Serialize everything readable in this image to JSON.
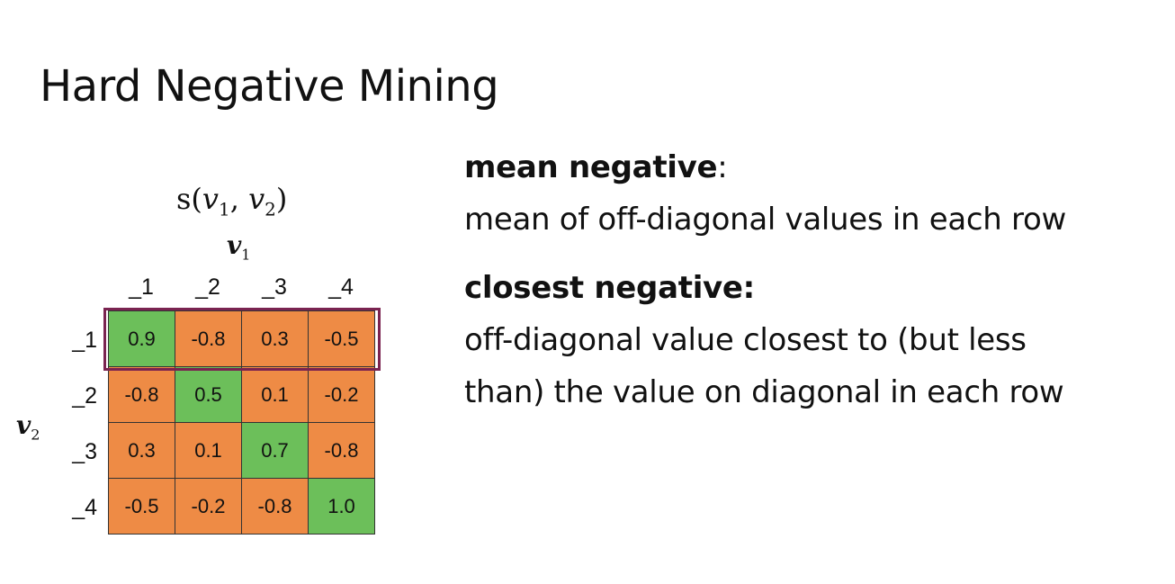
{
  "slide": {
    "title": "Hard Negative Mining"
  },
  "matrix": {
    "formula_prefix": "s(",
    "formula_v1": "v",
    "formula_v1_sub": "1",
    "formula_sep": ", ",
    "formula_v2": "v",
    "formula_v2_sub": "2",
    "formula_suffix": ")",
    "col_axis": "v",
    "col_axis_sub": "1",
    "row_axis": "v",
    "row_axis_sub": "2",
    "col_headers": [
      "_1",
      "_2",
      "_3",
      "_4"
    ],
    "row_headers": [
      "_1",
      "_2",
      "_3",
      "_4"
    ],
    "rows": [
      [
        "0.9",
        "-0.8",
        "0.3",
        "-0.5"
      ],
      [
        "-0.8",
        "0.5",
        "0.1",
        "-0.2"
      ],
      [
        "0.3",
        "0.1",
        "0.7",
        "-0.8"
      ],
      [
        "-0.5",
        "-0.2",
        "-0.8",
        "1.0"
      ]
    ],
    "colors": {
      "diagonal": "#6cbf5a",
      "off_diagonal": "#ee8b45",
      "highlight_border": "#7a2350"
    }
  },
  "definitions": {
    "mean_negative_term": "mean negative",
    "mean_negative_colon": ":",
    "mean_negative_desc": "mean of off-diagonal values in each row",
    "closest_negative_term": "closest negative:",
    "closest_negative_desc_1": "off-diagonal value closest to (but less",
    "closest_negative_desc_2": "than) the value on diagonal in each row"
  }
}
